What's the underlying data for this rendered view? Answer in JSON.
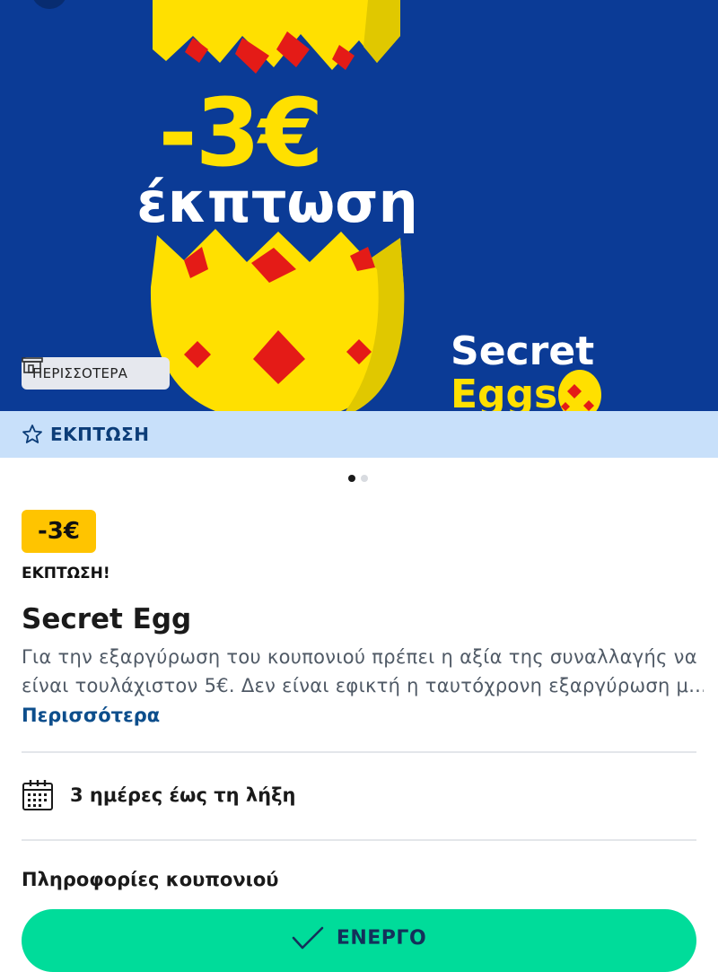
{
  "hero": {
    "discount_text": "-3€",
    "discount_word": "έκπτωση",
    "brand_line1": "Secret",
    "brand_line2": "Eggs",
    "more_chip_label": "ΠΕΡΙΣΣΟΤΕΡΑ",
    "colors": {
      "background": "#0b3b96",
      "egg": "#ffe000",
      "pattern": "#e41b17"
    }
  },
  "category_bar": {
    "icon": "star-outline-icon",
    "label": "ΕΚΠΤΩΣΗ"
  },
  "carousel": {
    "page_count": 2,
    "active_index": 0
  },
  "coupon": {
    "badge": "-3€",
    "subtitle": "ΕΚΠΤΩΣΗ!",
    "title": "Secret Egg",
    "description_line1": "Για την εξαργύρωση του κουπονιού πρέπει η αξία της συναλλαγής να",
    "description_line2": "είναι τουλάχιστον 5€. Δεν είναι εφικτή η ταυτόχρονη εξαργύρωση μ...",
    "more_link": "Περισσότερα"
  },
  "expiry": {
    "icon": "calendar-icon",
    "text": "3 ημέρες έως τη λήξη"
  },
  "info_section": {
    "heading": "Πληροφορίες κουπονιού"
  },
  "action_button": {
    "icon": "check-icon",
    "label": "ΕΝΕΡΓΟ",
    "color": "#00dc9a"
  }
}
